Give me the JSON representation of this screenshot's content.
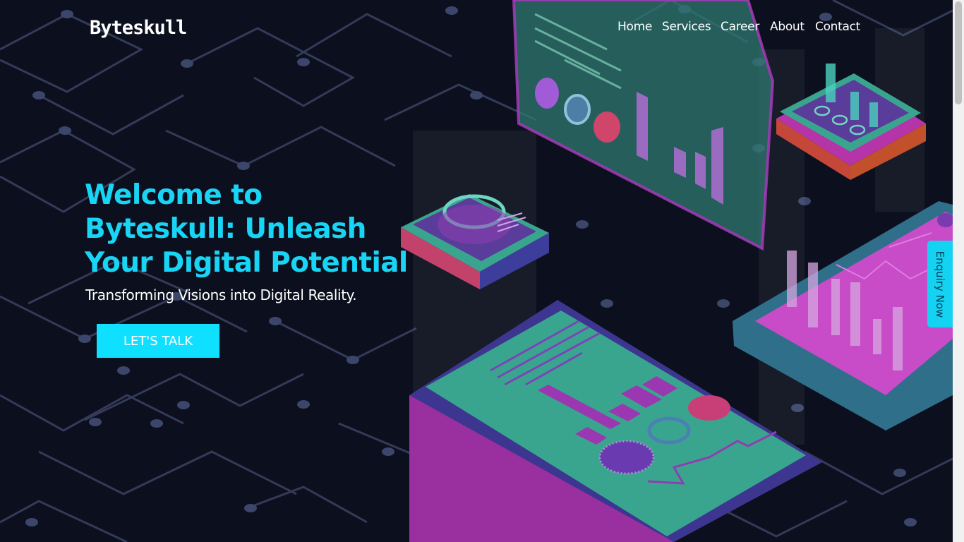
{
  "brand": {
    "logo_text": "Byteskull"
  },
  "nav": {
    "items": [
      {
        "label": "Home"
      },
      {
        "label": "Services"
      },
      {
        "label": "Career"
      },
      {
        "label": "About"
      },
      {
        "label": "Contact"
      }
    ]
  },
  "hero": {
    "title": "Welcome to Byteskull: Unleash Your Digital Potential",
    "subtitle": "Transforming Visions into Digital Reality.",
    "cta_label": "LET'S TALK"
  },
  "enquiry_tab": {
    "label": "Enquiry Now"
  },
  "colors": {
    "background": "#0c0f1d",
    "accent_cyan": "#18d4f5",
    "button": "#0fe0ff",
    "teal": "#3aa58f",
    "magenta": "#a63ab8"
  }
}
